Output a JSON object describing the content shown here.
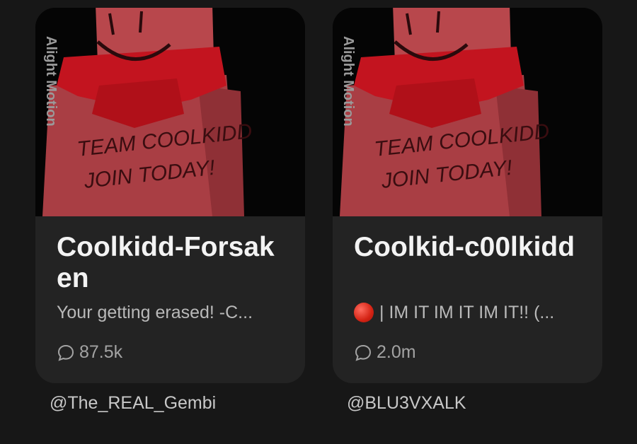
{
  "cards": [
    {
      "title": "Coolkidd-Forsaken",
      "description": "Your getting erased! -C...",
      "has_status_dot": false,
      "interactions": "87.5k",
      "creator": "@The_REAL_Gembi",
      "thumbnail": {
        "watermark": "Alight Motion",
        "sign_line1": "TEAM COOLKIDD",
        "sign_line2": "JOIN TODAY!"
      }
    },
    {
      "title": "Coolkid-c00lkidd",
      "description": "| IM IT IM IT IM IT!! (...",
      "has_status_dot": true,
      "interactions": "2.0m",
      "creator": "@BLU3VXALK",
      "thumbnail": {
        "watermark": "Alight Motion",
        "sign_line1": "TEAM COOLKIDD",
        "sign_line2": "JOIN TODAY!"
      }
    }
  ],
  "colors": {
    "background": "#171717",
    "card": "#232323",
    "title": "#f3f3f3",
    "subtitle": "#b9b9b9",
    "character_red": "#b8474c",
    "scarf_red": "#c3141f"
  },
  "icons": {
    "interactions": "chat-bubble-icon",
    "status": "red-circle-icon"
  }
}
